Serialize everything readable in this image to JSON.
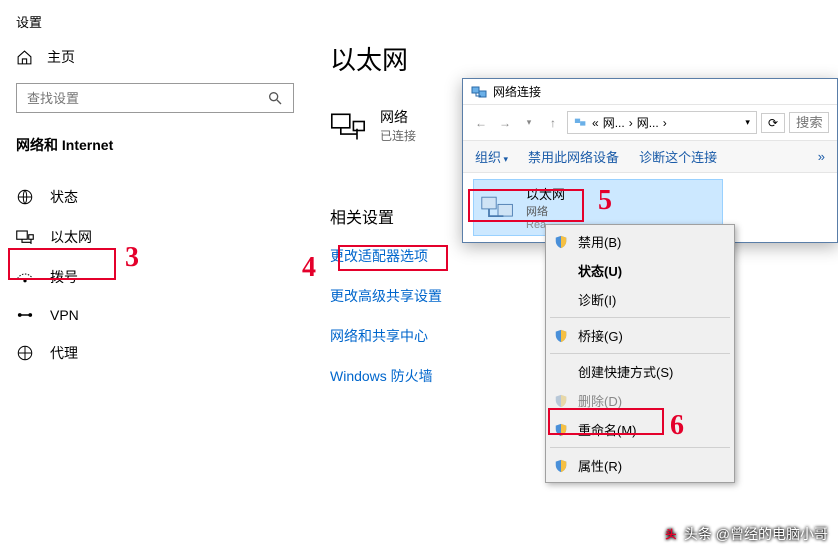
{
  "settings": {
    "title": "设置",
    "home": "主页",
    "search_placeholder": "查找设置",
    "category": "网络和 Internet",
    "nav": {
      "status": "状态",
      "ethernet": "以太网",
      "dialup": "拨号",
      "vpn": "VPN",
      "proxy": "代理"
    }
  },
  "main": {
    "heading": "以太网",
    "network_name": "网络",
    "network_state": "已连接",
    "related_header": "相关设置",
    "links": {
      "adapter": "更改适配器选项",
      "sharing": "更改高级共享设置",
      "center": "网络和共享中心",
      "firewall": "Windows 防火墙"
    }
  },
  "explorer": {
    "title": "网络连接",
    "bc1": "网...",
    "bc2": "网...",
    "search_placeholder": "搜索",
    "cmd_organize": "组织",
    "cmd_disable": "禁用此网络设备",
    "cmd_diagnose": "诊断这个连接",
    "conn": {
      "name": "以太网",
      "net": "网络",
      "adapter": "Rea..."
    }
  },
  "menu": {
    "disable": "禁用(B)",
    "status": "状态(U)",
    "diagnose": "诊断(I)",
    "bridge": "桥接(G)",
    "shortcut": "创建快捷方式(S)",
    "delete": "删除(D)",
    "rename": "重命名(M)",
    "properties": "属性(R)"
  },
  "annotations": {
    "a3": "3",
    "a4": "4",
    "a5": "5",
    "a6": "6"
  },
  "watermark": "头条 @曾经的电脑小哥"
}
